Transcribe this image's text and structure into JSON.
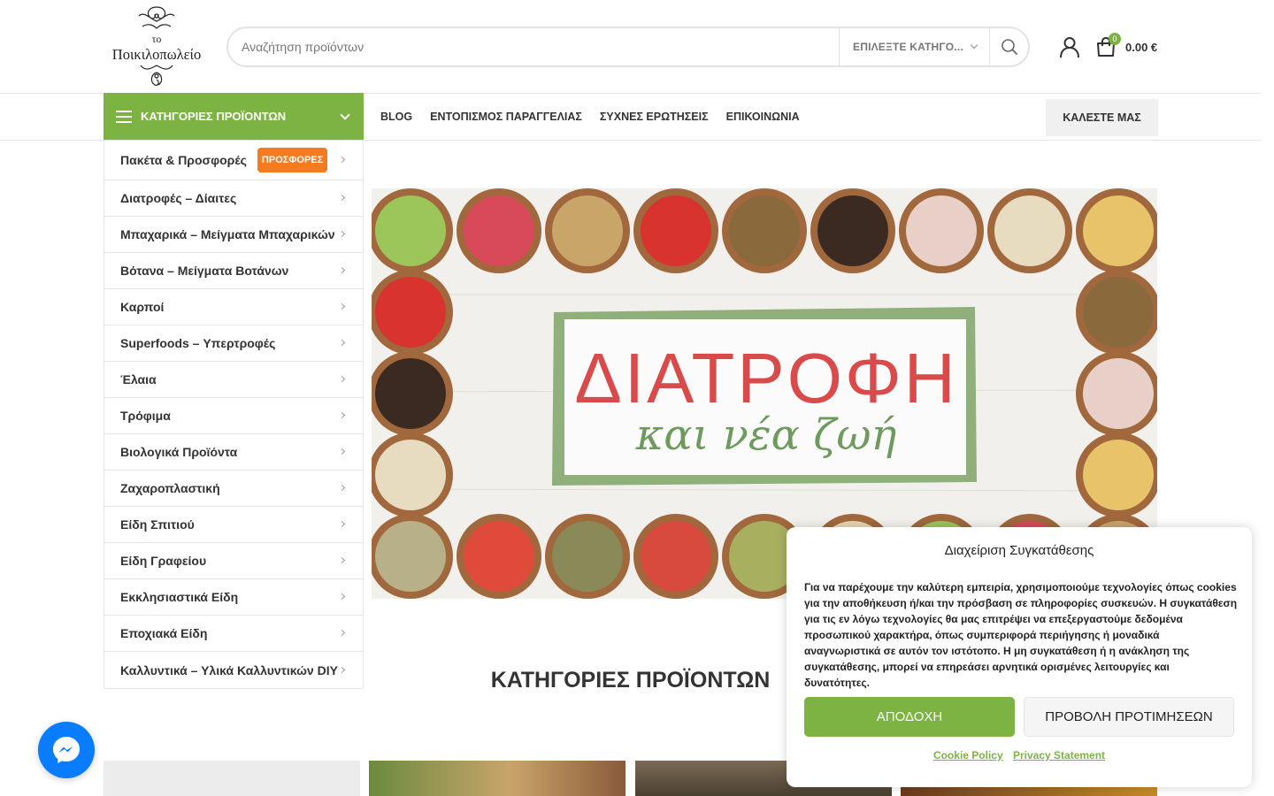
{
  "logo": {
    "line1": "το",
    "line2": "Ποικιλοπωλείο"
  },
  "search": {
    "placeholder": "Αναζήτηση προϊόντων",
    "category_label": "ΕΠΙΛΕΞΤΕ ΚΑΤΗΓΟ..."
  },
  "cart": {
    "count": "0",
    "total": "0.00 €"
  },
  "nav": {
    "categories_label": "ΚΑΤΗΓΟΡΙΕΣ ΠΡΟΪΟΝΤΩΝ",
    "links": [
      "BLOG",
      "ΕΝΤΟΠΙΣΜΟΣ ΠΑΡΑΓΓΕΛΙΑΣ",
      "ΣΥΧΝΕΣ ΕΡΩΤΗΣΕΙΣ",
      "ΕΠΙΚΟΙΝΩΝΙΑ"
    ],
    "call_label": "ΚΑΛΕΣΤΕ ΜΑΣ"
  },
  "sidebar": {
    "badge": "ΠΡΟΣΦΟΡΕΣ",
    "items": [
      "Πακέτα & Προσφορές",
      "Διατροφές – Δίαιτες",
      "Μπαχαρικά – Μείγματα Μπαχαρικών",
      "Βότανα – Μείγματα Βοτάνων",
      "Καρποί",
      "Superfoods – Υπερτροφές",
      "Έλαια",
      "Τρόφιμα",
      "Βιολογικά Προϊόντα",
      "Ζαχαροπλαστική",
      "Είδη Σπιτιού",
      "Είδη Γραφείου",
      "Εκκλησιαστικά Είδη",
      "Εποχιακά Είδη",
      "Καλλυντικά – Υλικά Καλλυντικών DIY"
    ]
  },
  "hero": {
    "title": "ΔΙΑΤΡΟΦΗ",
    "subtitle": "και νέα ζωή"
  },
  "section_title": "ΚΑΤΗΓΟΡΙΕΣ ΠΡΟΪΟΝΤΩΝ",
  "cookie": {
    "title": "Διαχείριση Συγκατάθεσης",
    "text": "Για να παρέχουμε την καλύτερη εμπειρία, χρησιμοποιούμε τεχνολογίες όπως cookies για την αποθήκευση ή/και την πρόσβαση σε πληροφορίες συσκευών. Η συγκατάθεση για τις εν λόγω τεχνολογίες θα μας επιτρέψει να επεξεργαστούμε δεδομένα προσωπικού χαρακτήρα, όπως συμπεριφορά περιήγησης ή μοναδικά αναγνωριστικά σε αυτόν τον ιστότοπο. Η μη συγκατάθεση ή η ανάκληση της συγκατάθεσης, μπορεί να επηρεάσει αρνητικά ορισμένες λειτουργίες και δυνατότητες.",
    "accept": "ΑΠΟΔΟΧΗ",
    "prefs": "ΠΡΟΒΟΛΗ ΠΡΟΤΙΜΗΣΕΩΝ",
    "link1": "Cookie Policy",
    "link2": "Privacy Statement"
  },
  "colors": {
    "accent": "#7cb342",
    "badge": "#f47b20",
    "messenger": "#0a7cff"
  },
  "icons": [
    "menu-icon",
    "search-icon",
    "user-icon",
    "cart-icon",
    "chevron-down-icon",
    "chevron-right-icon",
    "messenger-icon"
  ]
}
